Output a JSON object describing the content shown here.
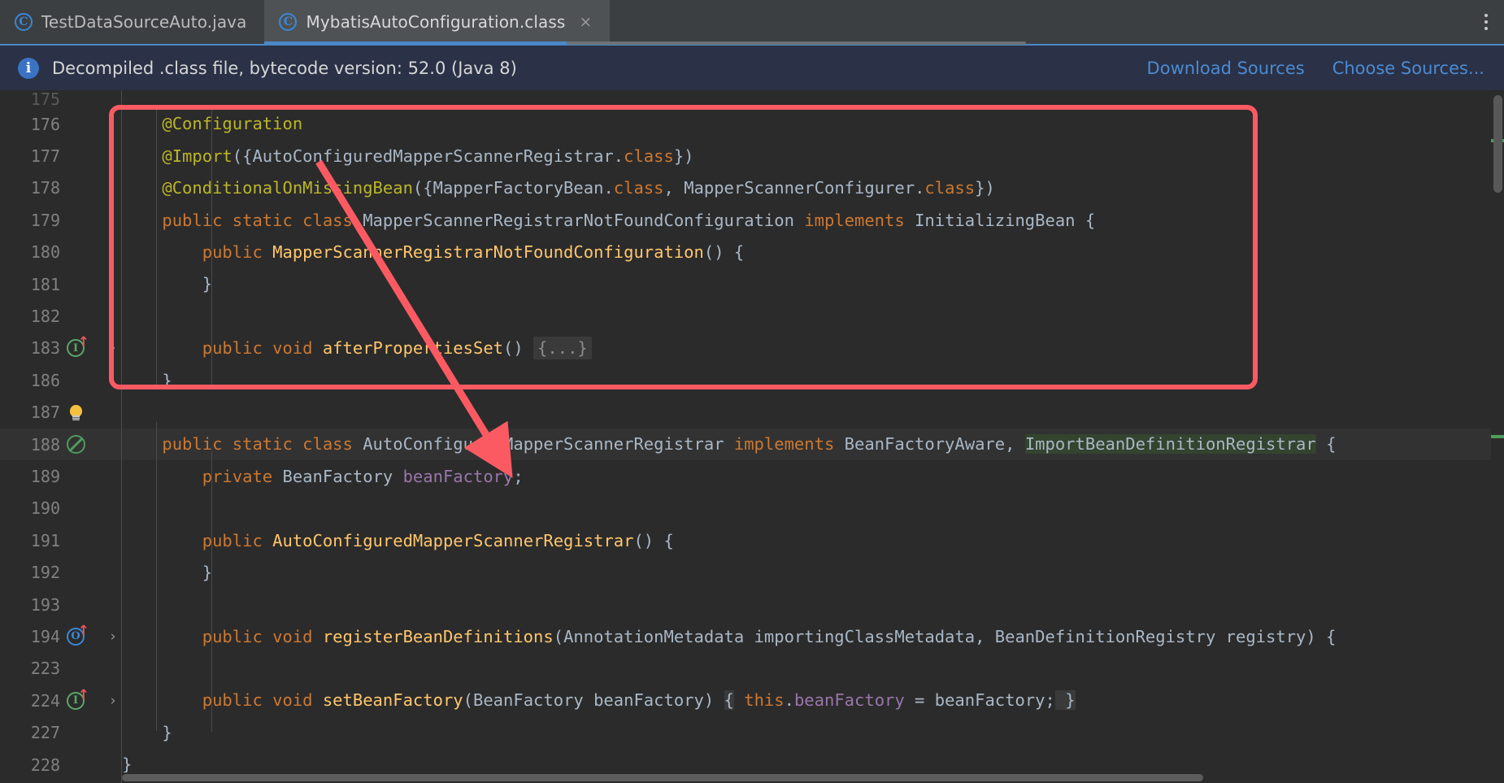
{
  "window": {
    "theme_bg": "#2b2b2b",
    "accent": "#4a88c7",
    "annotation_color": "#fc5a62"
  },
  "tabbar": {
    "tabs": [
      {
        "label": "TestDataSourceAuto.java",
        "icon": "java-class-icon",
        "active": false,
        "closable": false
      },
      {
        "label": "MybatisAutoConfiguration.class",
        "icon": "java-class-icon",
        "active": true,
        "closable": true,
        "close_glyph": "×"
      }
    ],
    "overflow_menu_label": "⋮"
  },
  "banner": {
    "icon": "info-icon",
    "icon_glyph": "i",
    "message": "Decompiled .class file, bytecode version: 52.0 (Java 8)",
    "links": [
      {
        "label": "Download Sources"
      },
      {
        "label": "Choose Sources..."
      }
    ]
  },
  "editor": {
    "lines": [
      {
        "num": "175",
        "gutter_icon": "",
        "fold_arrow": "",
        "partial": true,
        "tokens": []
      },
      {
        "num": "176",
        "gutter_icon": "",
        "fold_arrow": "",
        "tokens": [
          {
            "t": "    @Configuration",
            "c": "ann"
          }
        ]
      },
      {
        "num": "177",
        "gutter_icon": "",
        "fold_arrow": "",
        "tokens": [
          {
            "t": "    @Import",
            "c": "ann"
          },
          {
            "t": "({",
            "c": "punc"
          },
          {
            "t": "AutoConfiguredMapperScannerRegistrar",
            "c": "cls"
          },
          {
            "t": ".",
            "c": "punc"
          },
          {
            "t": "class",
            "c": "kw"
          },
          {
            "t": "})",
            "c": "punc"
          }
        ]
      },
      {
        "num": "178",
        "gutter_icon": "",
        "fold_arrow": "",
        "tokens": [
          {
            "t": "    @ConditionalOnMissingBean",
            "c": "ann"
          },
          {
            "t": "({",
            "c": "punc"
          },
          {
            "t": "MapperFactoryBean",
            "c": "cls"
          },
          {
            "t": ".",
            "c": "punc"
          },
          {
            "t": "class",
            "c": "kw"
          },
          {
            "t": ", ",
            "c": "punc"
          },
          {
            "t": "MapperScannerConfigurer",
            "c": "cls"
          },
          {
            "t": ".",
            "c": "punc"
          },
          {
            "t": "class",
            "c": "kw"
          },
          {
            "t": "})",
            "c": "punc"
          }
        ]
      },
      {
        "num": "179",
        "gutter_icon": "",
        "fold_arrow": "",
        "tokens": [
          {
            "t": "    public static class ",
            "c": "kw"
          },
          {
            "t": "MapperScannerRegistrarNotFoundConfiguration ",
            "c": "cls"
          },
          {
            "t": "implements ",
            "c": "kw"
          },
          {
            "t": "InitializingBean {",
            "c": "cls"
          }
        ]
      },
      {
        "num": "180",
        "gutter_icon": "",
        "fold_arrow": "",
        "tokens": [
          {
            "t": "        public ",
            "c": "kw"
          },
          {
            "t": "MapperScannerRegistrarNotFoundConfiguration",
            "c": "fn"
          },
          {
            "t": "() {",
            "c": "punc"
          }
        ]
      },
      {
        "num": "181",
        "gutter_icon": "",
        "fold_arrow": "",
        "tokens": [
          {
            "t": "        }",
            "c": "punc"
          }
        ]
      },
      {
        "num": "182",
        "gutter_icon": "",
        "fold_arrow": "",
        "tokens": []
      },
      {
        "num": "183",
        "gutter_icon": "implementing-method-icon",
        "fold_arrow": "›",
        "tokens": [
          {
            "t": "        public void ",
            "c": "kw"
          },
          {
            "t": "afterPropertiesSet",
            "c": "fn"
          },
          {
            "t": "() ",
            "c": "punc"
          },
          {
            "t": "{...}",
            "c": "fold"
          }
        ]
      },
      {
        "num": "186",
        "gutter_icon": "",
        "fold_arrow": "",
        "tokens": [
          {
            "t": "    }",
            "c": "punc"
          }
        ]
      },
      {
        "num": "187",
        "gutter_icon": "intention-bulb-icon",
        "fold_arrow": "",
        "tokens": []
      },
      {
        "num": "188",
        "gutter_icon": "suppress-inspection-icon",
        "fold_arrow": "",
        "highlight": true,
        "tokens": [
          {
            "t": "    public static class ",
            "c": "kw"
          },
          {
            "t": "AutoConfiguredMapperScannerRegistrar ",
            "c": "cls"
          },
          {
            "t": "implements ",
            "c": "kw"
          },
          {
            "t": "BeanFactoryAware, ",
            "c": "cls"
          },
          {
            "t": "ImportBeanDefinitionRegistrar",
            "c": "greenhl"
          },
          {
            "t": " {",
            "c": "punc"
          }
        ]
      },
      {
        "num": "189",
        "gutter_icon": "",
        "fold_arrow": "",
        "tokens": [
          {
            "t": "        private ",
            "c": "kw"
          },
          {
            "t": "BeanFactory ",
            "c": "cls"
          },
          {
            "t": "beanFactory",
            "c": "fld"
          },
          {
            "t": ";",
            "c": "punc"
          }
        ]
      },
      {
        "num": "190",
        "gutter_icon": "",
        "fold_arrow": "",
        "tokens": []
      },
      {
        "num": "191",
        "gutter_icon": "",
        "fold_arrow": "",
        "tokens": [
          {
            "t": "        public ",
            "c": "kw"
          },
          {
            "t": "AutoConfiguredMapperScannerRegistrar",
            "c": "fn"
          },
          {
            "t": "() {",
            "c": "punc"
          }
        ]
      },
      {
        "num": "192",
        "gutter_icon": "",
        "fold_arrow": "",
        "tokens": [
          {
            "t": "        }",
            "c": "punc"
          }
        ]
      },
      {
        "num": "193",
        "gutter_icon": "",
        "fold_arrow": "",
        "tokens": []
      },
      {
        "num": "194",
        "gutter_icon": "overriding-method-icon",
        "fold_arrow": "›",
        "tokens": [
          {
            "t": "        public void ",
            "c": "kw"
          },
          {
            "t": "registerBeanDefinitions",
            "c": "fn"
          },
          {
            "t": "(",
            "c": "punc"
          },
          {
            "t": "AnnotationMetadata importingClassMetadata, BeanDefinitionRegistry registry",
            "c": "cls"
          },
          {
            "t": ") {",
            "c": "punc"
          }
        ]
      },
      {
        "num": "223",
        "gutter_icon": "",
        "fold_arrow": "",
        "tokens": []
      },
      {
        "num": "224",
        "gutter_icon": "implementing-method-icon",
        "fold_arrow": "›",
        "tokens": [
          {
            "t": "        public void ",
            "c": "kw"
          },
          {
            "t": "setBeanFactory",
            "c": "fn"
          },
          {
            "t": "(",
            "c": "punc"
          },
          {
            "t": "BeanFactory beanFactory",
            "c": "cls"
          },
          {
            "t": ") ",
            "c": "punc"
          },
          {
            "t": "{",
            "c": "greyhl"
          },
          {
            "t": " ",
            "c": "punc"
          },
          {
            "t": "this",
            "c": "kw"
          },
          {
            "t": ".",
            "c": "punc"
          },
          {
            "t": "beanFactory",
            "c": "fld"
          },
          {
            "t": " = beanFactory",
            "c": "ident"
          },
          {
            "t": ";",
            "c": "punc"
          },
          {
            "t": " }",
            "c": "greyhl"
          }
        ]
      },
      {
        "num": "227",
        "gutter_icon": "",
        "fold_arrow": "",
        "tokens": [
          {
            "t": "    }",
            "c": "punc"
          }
        ]
      },
      {
        "num": "228",
        "gutter_icon": "",
        "fold_arrow": "",
        "tokens": [
          {
            "t": "}",
            "c": "punc"
          }
        ]
      }
    ]
  },
  "annotation": {
    "type": "red-callout",
    "shapes": [
      "rounded-rectangle",
      "arrow"
    ],
    "color": "#fc5a62",
    "points_from_line": "177",
    "points_to_line": "188"
  }
}
